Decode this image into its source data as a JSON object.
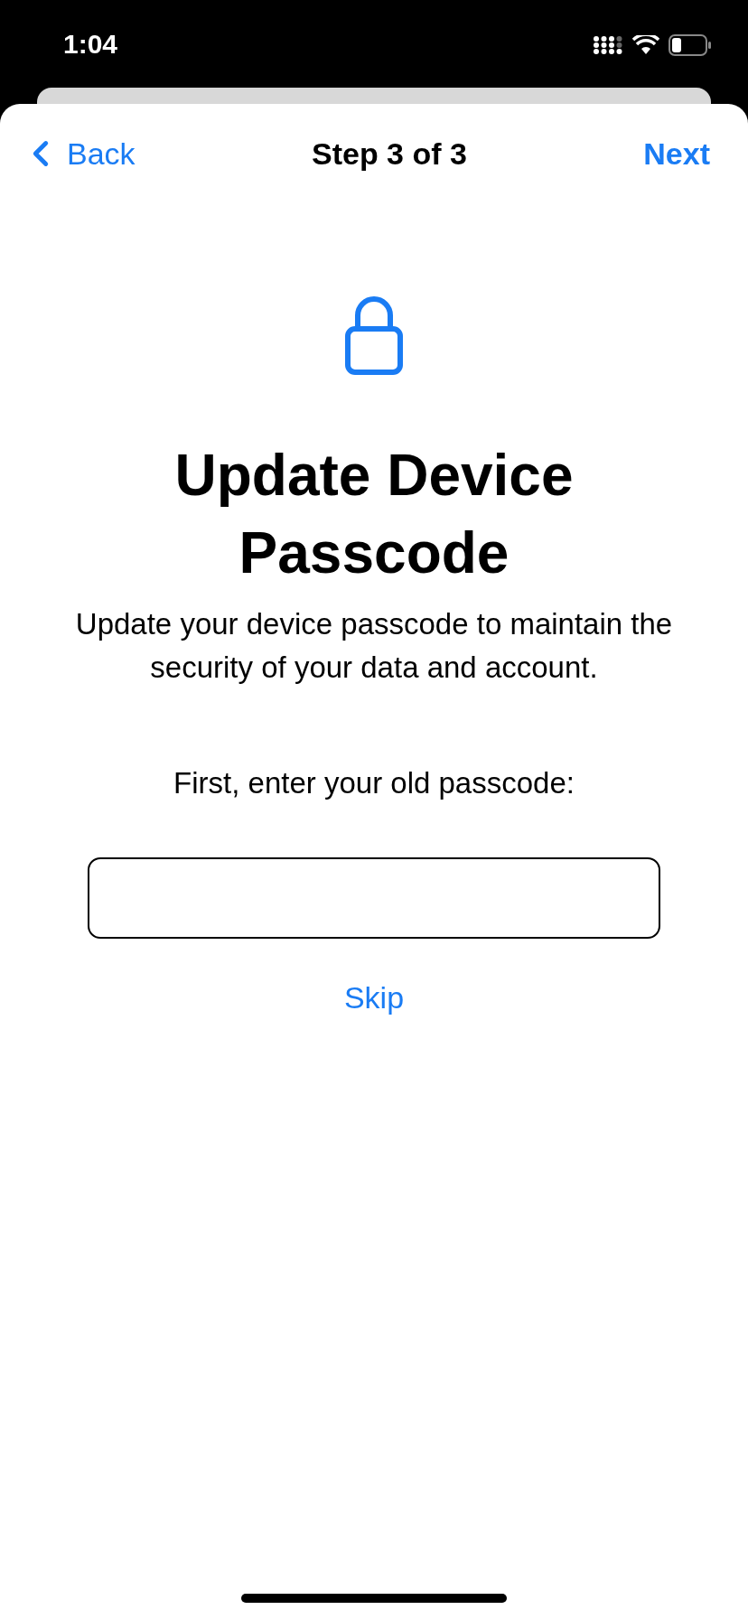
{
  "status_bar": {
    "time": "1:04"
  },
  "nav": {
    "back": "Back",
    "title": "Step 3 of 3",
    "next": "Next"
  },
  "title": "Update Device Passcode",
  "description": "Update your device passcode to maintain the security of your data and account.",
  "prompt": "First, enter your old passcode:",
  "skip": "Skip"
}
